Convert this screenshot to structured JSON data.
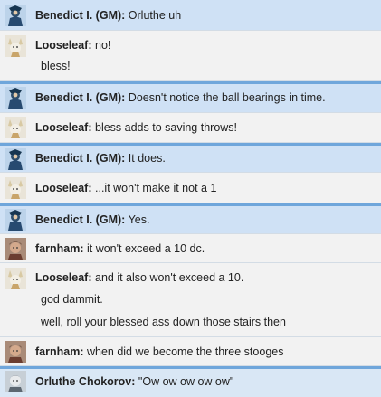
{
  "messages": [
    {
      "speaker": "Benedict I. (GM):",
      "avatar": "gm-avatar-icon",
      "lines": [
        "Orluthe uh"
      ]
    },
    {
      "speaker": "Looseleaf:",
      "avatar": "looseleaf-avatar-icon",
      "lines": [
        "no!",
        "bless!"
      ]
    },
    {
      "speaker": "Benedict I. (GM):",
      "avatar": "gm-avatar-icon",
      "lines": [
        "Doesn't notice the ball bearings in time."
      ]
    },
    {
      "speaker": "Looseleaf:",
      "avatar": "looseleaf-avatar-icon",
      "lines": [
        "bless adds to saving throws!"
      ]
    },
    {
      "speaker": "Benedict I. (GM):",
      "avatar": "gm-avatar-icon",
      "lines": [
        "It does."
      ]
    },
    {
      "speaker": "Looseleaf:",
      "avatar": "looseleaf-avatar-icon",
      "lines": [
        "...it won't make it not a 1"
      ]
    },
    {
      "speaker": "Benedict I. (GM):",
      "avatar": "gm-avatar-icon",
      "lines": [
        "Yes."
      ]
    },
    {
      "speaker": "farnham:",
      "avatar": "farnham-avatar-icon",
      "lines": [
        "it won't exceed a 10 dc."
      ]
    },
    {
      "speaker": "Looseleaf:",
      "avatar": "looseleaf-avatar-icon",
      "lines": [
        "and it also won't exceed a 10.",
        "god dammit.",
        "well, roll your blessed ass down those stairs then"
      ]
    },
    {
      "speaker": "farnham:",
      "avatar": "farnham-avatar-icon",
      "lines": [
        "when did we become the three stooges"
      ]
    },
    {
      "speaker": "Orluthe Chokorov:",
      "avatar": "orluthe-avatar-icon",
      "lines": [
        "\"Ow ow ow ow ow\""
      ]
    }
  ],
  "colors": {
    "gm_row": "#cfe1f5",
    "player_row": "#f2f2f2",
    "gm_rule": "#6fa6db"
  }
}
